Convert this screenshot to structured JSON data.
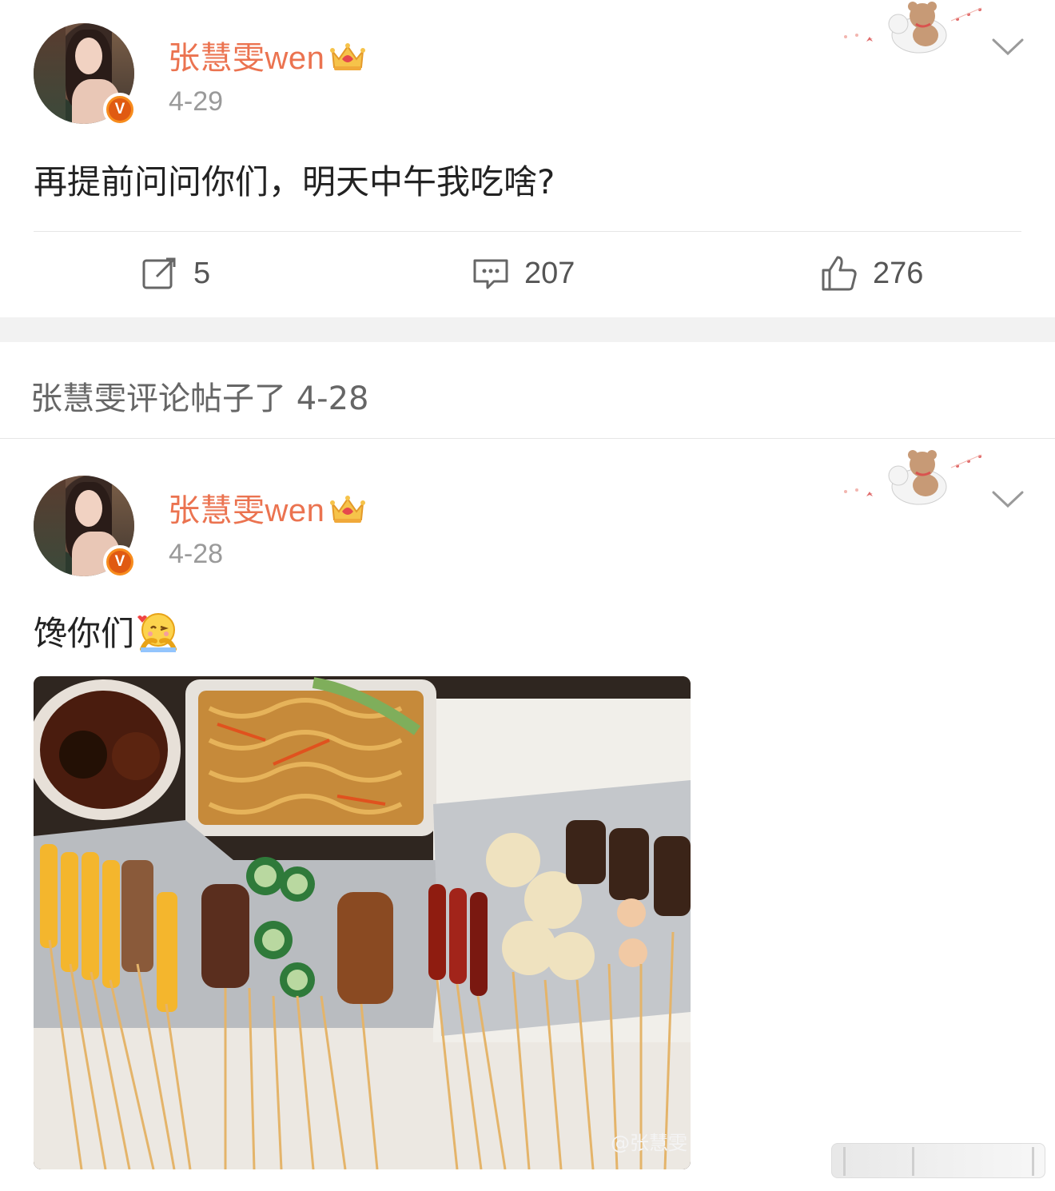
{
  "posts": [
    {
      "username": "张慧雯wen",
      "date": "4-29",
      "text": "再提前问问你们，明天中午我吃啥?",
      "actions": {
        "repost": "5",
        "comment": "207",
        "like": "276"
      }
    },
    {
      "username": "张慧雯wen",
      "date": "4-28",
      "text": "馋你们",
      "image_watermark": "@张慧雯"
    }
  ],
  "section_header": "张慧雯评论帖子了 4-28",
  "colors": {
    "username": "#eb7350",
    "verified_badge": "#f78c1d",
    "meta_text": "#9a9a9a",
    "divider_band": "#f2f2f2"
  },
  "icons": [
    "verified-badge-icon",
    "crown-icon",
    "chevron-down-icon",
    "repost-icon",
    "comment-icon",
    "like-icon",
    "hug-emoji-icon"
  ]
}
